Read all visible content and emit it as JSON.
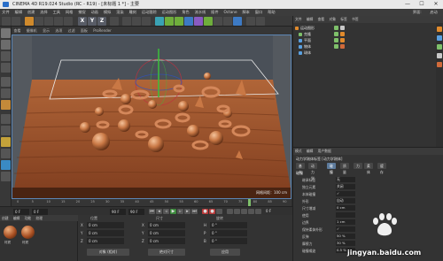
{
  "window": {
    "title": "CINEMA 4D R19.024 Studio (RC - R19) - [未标题 1 *] - 主要",
    "controls": [
      "—",
      "☐",
      "✕"
    ]
  },
  "menubar": {
    "items": [
      "文件",
      "编辑",
      "创建",
      "选择",
      "工具",
      "网格",
      "捕捉",
      "动画",
      "模拟",
      "渲染",
      "雕刻",
      "运动跟踪",
      "运动图形",
      "角色",
      "流水线",
      "插件",
      "Octane",
      "脚本",
      "窗口",
      "帮助"
    ],
    "layout_label": "界面:",
    "layout_value": "启动"
  },
  "toolbar": {
    "axis_labels": [
      "X",
      "Y",
      "Z"
    ]
  },
  "viewport": {
    "menu": [
      "查看",
      "摄像机",
      "显示",
      "选项",
      "过滤",
      "面板",
      "ProRender"
    ],
    "projection": "透视视图",
    "grid_status": "网格间距：100 cm"
  },
  "timeline": {
    "ticks": [
      "0",
      "5",
      "10",
      "15",
      "20",
      "25",
      "30",
      "35",
      "40",
      "45",
      "50",
      "55",
      "60",
      "65",
      "70",
      "75",
      "80",
      "85",
      "90"
    ],
    "start_field": "0 F",
    "current_field": "0 F",
    "end_field": "90 F",
    "end_field2": "90 F",
    "frame_readout": "0 F"
  },
  "materials": {
    "menu": [
      "创建",
      "编辑",
      "功能",
      "纹理"
    ],
    "items": [
      "材质",
      "材质"
    ]
  },
  "coordinates": {
    "headers": [
      "位置",
      "尺寸",
      "旋转"
    ],
    "rows": [
      {
        "axis": "X",
        "pos": "0 cm",
        "size": "0 cm",
        "rot_label": "H",
        "rot": "0 °"
      },
      {
        "axis": "Y",
        "pos": "0 cm",
        "size": "0 cm",
        "rot_label": "P",
        "rot": "0 °"
      },
      {
        "axis": "Z",
        "pos": "0 cm",
        "size": "0 cm",
        "rot_label": "B",
        "rot": "0 °"
      }
    ],
    "mode": "对象 (相对)",
    "size_mode": "绝对尺寸",
    "apply": "应用"
  },
  "object_manager": {
    "menu": [
      "文件",
      "编辑",
      "查看",
      "对象",
      "标签",
      "书签"
    ],
    "objects": [
      {
        "name": "运动图形",
        "color": "#5aa0e0"
      },
      {
        "name": "克隆",
        "color": "#7ec06a"
      },
      {
        "name": "平面",
        "color": "#5aa0e0"
      },
      {
        "name": "物体",
        "color": "#5aa0e0"
      },
      {
        "name": "球体",
        "color": "#5aa0e0"
      }
    ]
  },
  "attributes": {
    "menu": [
      "模式",
      "编辑",
      "用户数据"
    ],
    "object_title": "动力学刚体标签 [动力学刚体]",
    "tabs": [
      "基本",
      "动力学",
      "碰撞",
      "质量",
      "力",
      "柔体",
      "缓存"
    ],
    "active_tab": "碰撞",
    "section": "碰撞",
    "props": [
      {
        "label": "继承标签",
        "value": "无"
      },
      {
        "label": "独立元素",
        "value": "关闭"
      },
      {
        "label": "本体碰撞",
        "value": "✓"
      },
      {
        "label": "外形",
        "value": "自动"
      },
      {
        "label": "尺寸增减",
        "value": "0 cm"
      },
      {
        "label": "使用",
        "value": ""
      },
      {
        "label": "边界",
        "value": "1 cm"
      },
      {
        "label": "保持柔体外形",
        "value": "✓"
      },
      {
        "label": "反弹",
        "value": "50 %"
      },
      {
        "label": "摩擦力",
        "value": "30 %"
      },
      {
        "label": "碰撞噪波",
        "value": "0.5 %"
      }
    ]
  },
  "watermark": {
    "text": "jingyan.baidu.com"
  }
}
